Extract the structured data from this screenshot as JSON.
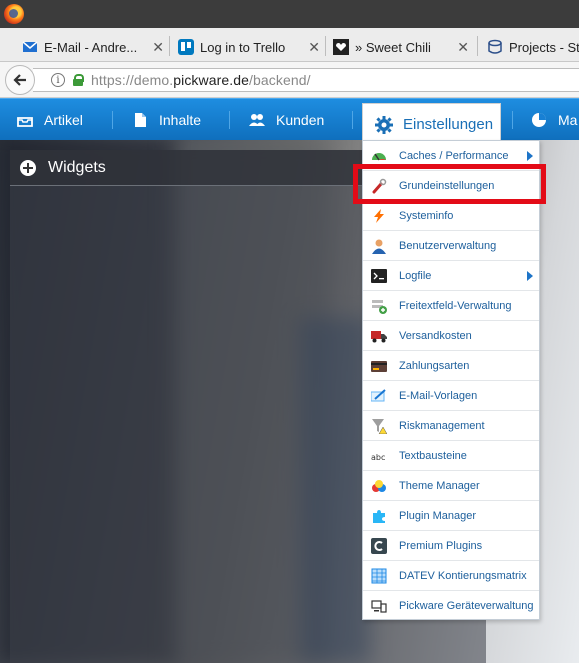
{
  "browser": {
    "tabs": [
      {
        "label": "E-Mail - Andre...",
        "close": "✕"
      },
      {
        "label": "Log in to Trello",
        "close": "✕"
      },
      {
        "label": "» Sweet Chili",
        "close": "✕"
      },
      {
        "label": "Projects - St",
        "close": ""
      }
    ],
    "url": {
      "prefix": "https://demo.",
      "domain": "pickware.de",
      "path": "/backend/"
    }
  },
  "menu": {
    "items": [
      {
        "label": "Artikel",
        "icon": "inbox-icon"
      },
      {
        "label": "Inhalte",
        "icon": "document-icon"
      },
      {
        "label": "Kunden",
        "icon": "users-icon"
      },
      {
        "label": "Einstellungen",
        "icon": "gear-icon"
      },
      {
        "label": "Ma",
        "icon": "pie-chart-icon"
      }
    ]
  },
  "widgets": {
    "title": "Widgets"
  },
  "dropdown": {
    "items": [
      {
        "label": "Caches / Performance",
        "icon": "speedometer-icon",
        "submenu": true
      },
      {
        "label": "Grundeinstellungen",
        "icon": "wrench-icon",
        "submenu": false,
        "highlighted": true
      },
      {
        "label": "Systeminfo",
        "icon": "lightning-icon",
        "submenu": false
      },
      {
        "label": "Benutzerverwaltung",
        "icon": "user-icon",
        "submenu": false
      },
      {
        "label": "Logfile",
        "icon": "terminal-icon",
        "submenu": true
      },
      {
        "label": "Freitextfeld-Verwaltung",
        "icon": "form-add-icon",
        "submenu": false
      },
      {
        "label": "Versandkosten",
        "icon": "truck-icon",
        "submenu": false
      },
      {
        "label": "Zahlungsarten",
        "icon": "credit-card-icon",
        "submenu": false
      },
      {
        "label": "E-Mail-Vorlagen",
        "icon": "envelope-edit-icon",
        "submenu": false
      },
      {
        "label": "Riskmanagement",
        "icon": "filter-warning-icon",
        "submenu": false
      },
      {
        "label": "Textbausteine",
        "icon": "abc-icon",
        "submenu": false
      },
      {
        "label": "Theme Manager",
        "icon": "color-drops-icon",
        "submenu": false
      },
      {
        "label": "Plugin Manager",
        "icon": "puzzle-icon",
        "submenu": false
      },
      {
        "label": "Premium Plugins",
        "icon": "premium-c-icon",
        "submenu": false
      },
      {
        "label": "DATEV Kontierungsmatrix",
        "icon": "table-icon",
        "submenu": false
      },
      {
        "label": "Pickware Geräteverwaltung",
        "icon": "devices-icon",
        "submenu": false
      }
    ]
  },
  "colors": {
    "menu_blue": "#1880d4",
    "link_blue": "#1d5f9c",
    "highlight_red": "#e30b17"
  }
}
